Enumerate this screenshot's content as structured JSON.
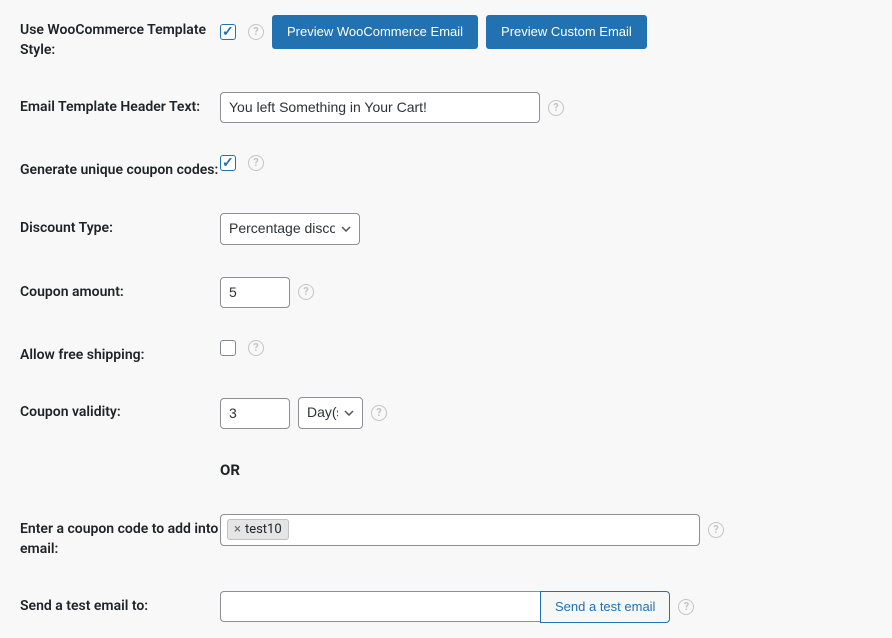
{
  "rows": {
    "use_wc_template": {
      "label": "Use WooCommerce Template Style:",
      "checked": true,
      "preview_wc_btn": "Preview WooCommerce Email",
      "preview_custom_btn": "Preview Custom Email"
    },
    "header_text": {
      "label": "Email Template Header Text:",
      "value": "You left Something in Your Cart!"
    },
    "unique_coupon": {
      "label": "Generate unique coupon codes:",
      "checked": true
    },
    "discount_type": {
      "label": "Discount Type:",
      "selected": "Percentage discount"
    },
    "coupon_amount": {
      "label": "Coupon amount:",
      "value": "5"
    },
    "free_shipping": {
      "label": "Allow free shipping:",
      "checked": false
    },
    "coupon_validity": {
      "label": "Coupon validity:",
      "value": "3",
      "unit": "Day(s)"
    },
    "or_divider": "OR",
    "coupon_code": {
      "label": "Enter a coupon code to add into email:",
      "tag": "test10"
    },
    "test_email": {
      "label": "Send a test email to:",
      "value": "",
      "button": "Send a test email"
    }
  }
}
